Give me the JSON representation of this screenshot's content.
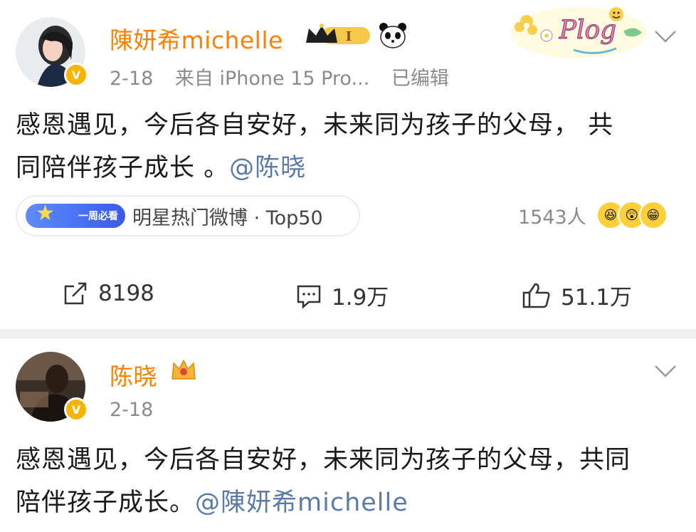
{
  "post1": {
    "username": "陳妍希michelle",
    "level_badge": "I",
    "date": "2-18",
    "source": "来自 iPhone 15 Pro...",
    "edited": "已编辑",
    "content_line1": "感恩遇见，今后各自安好，未来同为孩子的父母， 共",
    "content_line2": "同陪伴孩子成长 。",
    "mention": "@陈晓",
    "topic_badge": "一周必看",
    "topic_text": "明星热门微博 · Top50",
    "react_count": "1543人",
    "repost_count": "8198",
    "comment_count": "1.9万",
    "like_count": "51.1万",
    "plog_text": "Plog",
    "icons": {
      "repost": "share-icon",
      "comment": "comment-icon",
      "like": "thumbs-up-icon",
      "more": "chevron-down-icon",
      "crown": "crown-badge-icon",
      "panda": "panda-icon",
      "verified": "verified-v-icon"
    }
  },
  "post2": {
    "username": "陈晓",
    "date": "2-18",
    "content_line1": "感恩遇见，今后各自安好，未来同为孩子的父母，共同",
    "content_line2": "陪伴孩子成长。",
    "mention": "@陳妍希michelle"
  },
  "colors": {
    "username": "#ff7f00",
    "mention": "#5a7aa8",
    "meta": "#8a8a8a",
    "verified": "#f7b500"
  }
}
